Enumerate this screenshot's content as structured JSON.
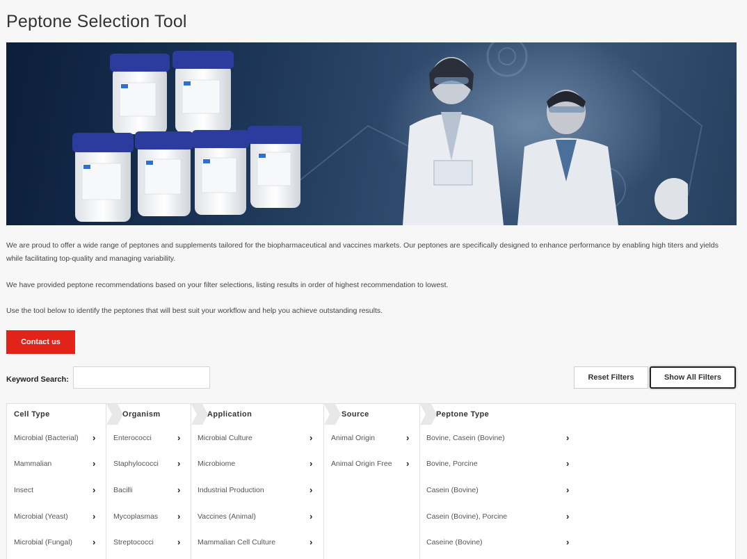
{
  "page": {
    "title": "Peptone Selection Tool"
  },
  "intro": {
    "paragraph1": "We are proud to offer a wide range of peptones and supplements tailored for the biopharmaceutical and vaccines markets. Our peptones are specifically designed to enhance performance by enabling high titers and yields while facilitating top-quality and managing variability.",
    "paragraph2": "We have provided peptone recommendations based on your filter selections, listing results in order of highest recommendation to lowest.",
    "paragraph3": "Use the tool below to identify the peptones that will best suit your workflow and help you achieve outstanding results."
  },
  "contact": {
    "label": "Contact us"
  },
  "search": {
    "label": "Keyword Search:",
    "value": "",
    "placeholder": ""
  },
  "actions": {
    "reset_label": "Reset Filters",
    "show_all_label": "Show All Filters"
  },
  "filters": {
    "cell_type": {
      "heading": "Cell Type",
      "items": [
        "Microbial (Bacterial)",
        "Mammalian",
        "Insect",
        "Microbial (Yeast)",
        "Microbial (Fungal)"
      ]
    },
    "organism": {
      "heading": "Organism",
      "items": [
        "Enterococci",
        "Staphylococci",
        "Bacilli",
        "Mycoplasmas",
        "Streptococci"
      ]
    },
    "application": {
      "heading": "Application",
      "items": [
        "Microbial Culture",
        "Microbiome",
        "Industrial Production",
        "Vaccines (Animal)",
        "Mammalian Cell Culture"
      ]
    },
    "source": {
      "heading": "Source",
      "items": [
        "Animal Origin",
        "Animal Origin Free"
      ]
    },
    "peptone_type": {
      "heading": "Peptone Type",
      "items": [
        "Bovine, Casein (Bovine)",
        "Bovine, Porcine",
        "Casein (Bovine)",
        "Casein (Bovine), Porcine",
        "Caseine (Bovine)"
      ]
    }
  },
  "hero": {
    "jar_labels": [
      "gibco",
      "gibco",
      "gibco",
      "gibco",
      "gibco",
      "gibco"
    ]
  },
  "icons": {
    "arrow": "chevron-right-icon",
    "tab": "tab-notch-icon"
  },
  "colors": {
    "accent": "#e2231a",
    "hero_dark": "#0b1e3a",
    "jar_cap": "#2b3c9e"
  }
}
